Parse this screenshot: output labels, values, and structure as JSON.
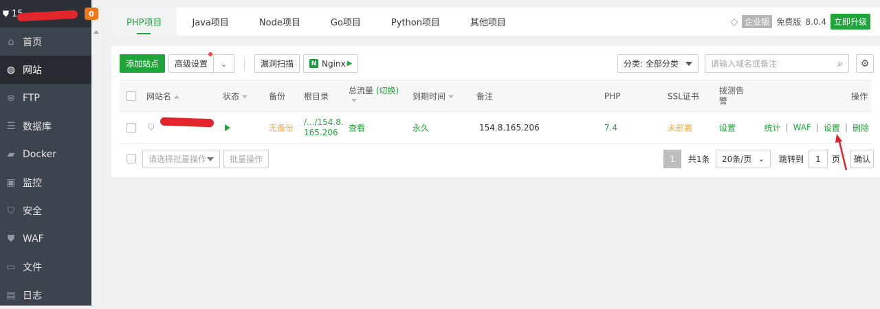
{
  "sidebar": {
    "server_name": "15...",
    "badge": "0",
    "items": [
      {
        "label": "首页",
        "icon": "home-icon"
      },
      {
        "label": "网站",
        "icon": "globe-icon"
      },
      {
        "label": "FTP",
        "icon": "ftp-icon"
      },
      {
        "label": "数据库",
        "icon": "database-icon"
      },
      {
        "label": "Docker",
        "icon": "docker-icon"
      },
      {
        "label": "监控",
        "icon": "monitor-icon"
      },
      {
        "label": "安全",
        "icon": "shield-icon"
      },
      {
        "label": "WAF",
        "icon": "waf-icon"
      },
      {
        "label": "文件",
        "icon": "folder-icon"
      },
      {
        "label": "日志",
        "icon": "log-icon"
      }
    ]
  },
  "tabs": [
    "PHP项目",
    "Java项目",
    "Node项目",
    "Go项目",
    "Python项目",
    "其他项目"
  ],
  "topright": {
    "enterprise": "企业版",
    "free": "免费版",
    "version": "8.0.4",
    "upgrade": "立即升级"
  },
  "toolbar": {
    "add_site": "添加站点",
    "advanced": "高级设置",
    "vuln_scan": "漏洞扫描",
    "nginx": "Nginx",
    "category": "分类: 全部分类",
    "search_placeholder": "请输入域名或备注"
  },
  "table": {
    "headers": {
      "site": "网站名",
      "status": "状态",
      "backup": "备份",
      "root": "根目录",
      "traffic": "总流量",
      "traffic_switch": "(切换)",
      "expire": "到期时间",
      "remark": "备注",
      "php": "PHP",
      "ssl": "SSL证书",
      "probe_line1": "拨测告",
      "probe_line2": "警",
      "ops": "操作"
    },
    "rows": [
      {
        "backup": "无备份",
        "root_line1": "/.../154.8.",
        "root_line2": "165.206",
        "traffic": "查看",
        "expire": "永久",
        "remark": "154.8.165.206",
        "php": "7.4",
        "ssl": "未部署",
        "probe": "设置",
        "ops": [
          "统计",
          "WAF",
          "设置",
          "删除"
        ]
      }
    ]
  },
  "footer": {
    "batch_placeholder": "请选择批量操作",
    "batch_btn": "批量操作",
    "page": "1",
    "total": "共1条",
    "per_page": "20条/页",
    "jump": "跳转到",
    "jump_value": "1",
    "page_unit": "页",
    "confirm": "确认"
  }
}
